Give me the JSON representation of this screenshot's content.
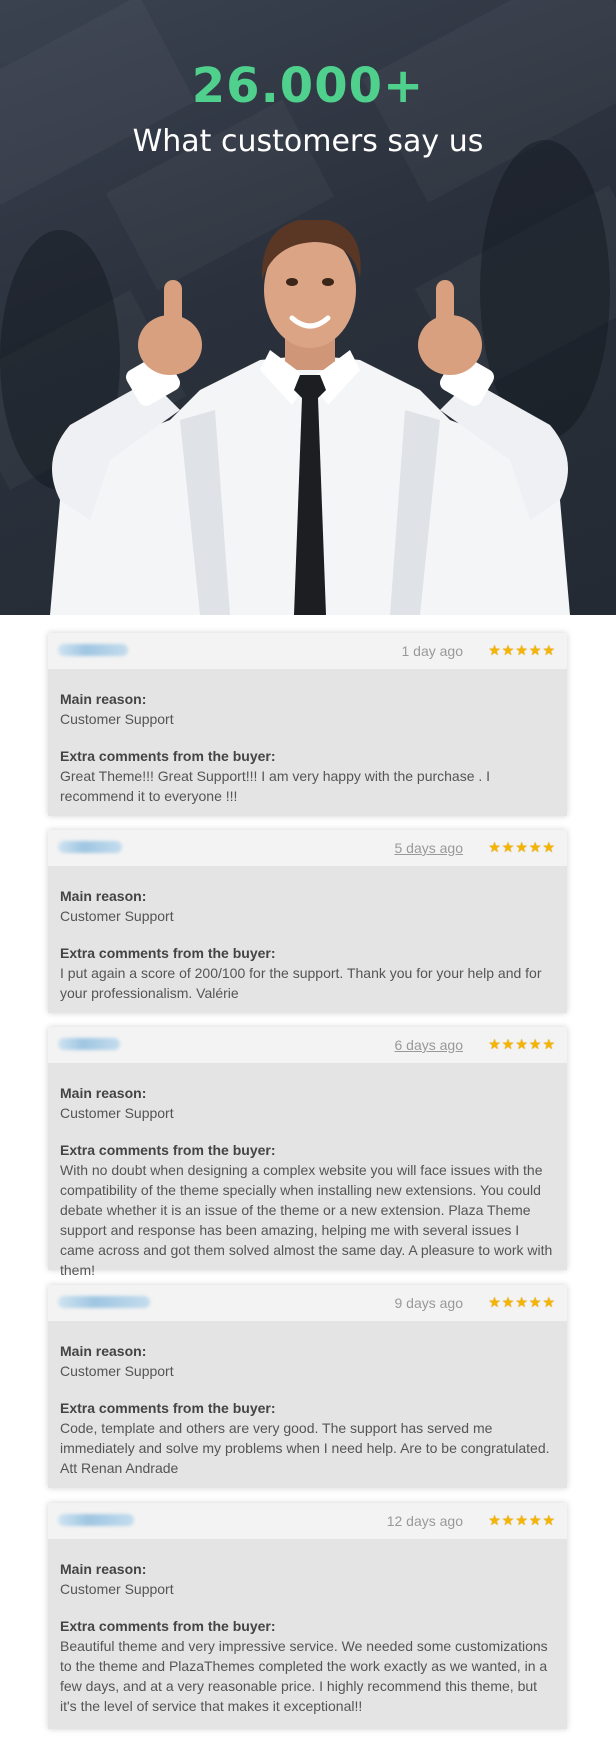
{
  "hero": {
    "headline": "26.000+",
    "subhead": "What customers say us",
    "accent_color": "#4fd18d"
  },
  "reviews": [
    {
      "date": "1 day ago",
      "date_is_link": false,
      "rating": 5,
      "reason_label": "Main reason:",
      "reason": "Customer Support",
      "comments_label": "Extra comments from the buyer:",
      "comments": "Great Theme!!! Great Support!!! I am very happy with the purchase . I recommend it to everyone !!!"
    },
    {
      "date": "5 days ago",
      "date_is_link": true,
      "rating": 5,
      "reason_label": "Main reason:",
      "reason": "Customer Support",
      "comments_label": "Extra comments from the buyer:",
      "comments": "I put again a score of 200/100 for the support. Thank you for your help and for your professionalism. Valérie"
    },
    {
      "date": "6 days ago",
      "date_is_link": true,
      "rating": 5,
      "reason_label": "Main reason:",
      "reason": "Customer Support",
      "comments_label": "Extra comments from the buyer:",
      "comments": "With no doubt when designing a complex website you will face issues with the compatibility of the theme specially when installing new extensions. You could debate whether it is an issue of the theme or a new extension. Plaza Theme support and response has been amazing, helping me with several issues I came across and got them solved almost the same day. A pleasure to work with them!"
    },
    {
      "date": "9 days ago",
      "date_is_link": false,
      "rating": 5,
      "reason_label": "Main reason:",
      "reason": "Customer Support",
      "comments_label": "Extra comments from the buyer:",
      "comments": "Code, template and others are very good. The support has served me immediately and solve my problems when I need help. Are to be congratulated. Att Renan Andrade"
    },
    {
      "date": "12 days ago",
      "date_is_link": false,
      "rating": 5,
      "reason_label": "Main reason:",
      "reason": "Customer Support",
      "comments_label": "Extra comments from the buyer:",
      "comments": "Beautiful theme and very impressive service. We needed some customizations to the theme and PlazaThemes completed the work exactly as we wanted, in a few days, and at a very reasonable price. I highly recommend this theme, but it's the level of service that makes it exceptional!!"
    }
  ]
}
